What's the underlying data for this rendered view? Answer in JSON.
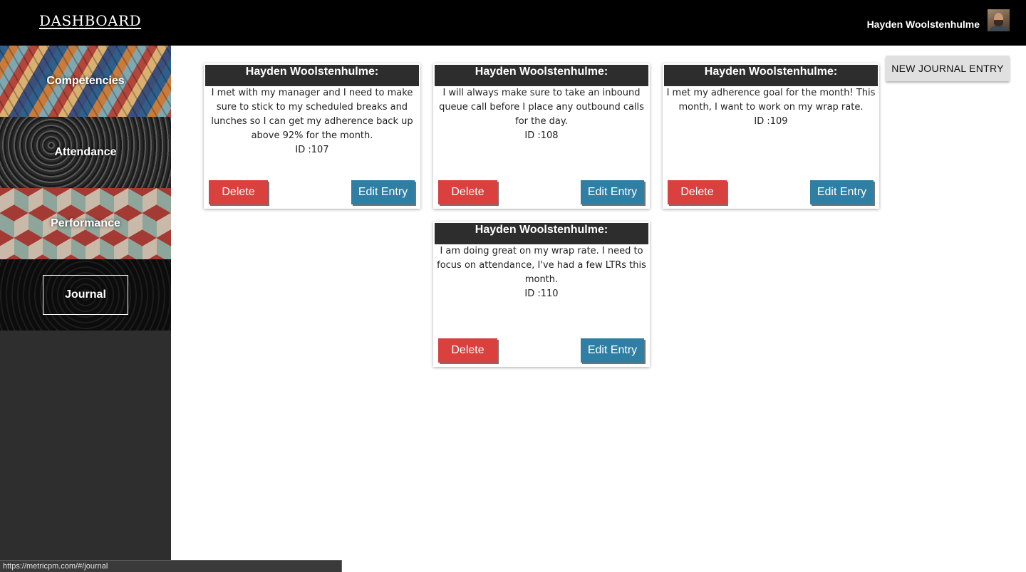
{
  "header": {
    "brand": "DASHBOARD",
    "user_name": "Hayden Woolstenhulme"
  },
  "sidebar": {
    "items": [
      {
        "label": "Competencies"
      },
      {
        "label": "Attendance"
      },
      {
        "label": "Performance"
      },
      {
        "label": "Journal"
      }
    ]
  },
  "toolbar": {
    "new_entry_label": "NEW JOURNAL ENTRY"
  },
  "entries": [
    {
      "author": "Hayden Woolstenhulme:",
      "text": "I met with my manager and I need to make sure to stick to my scheduled breaks and lunches so I can get my adherence back up above 92% for the month.",
      "id_label": "ID :107",
      "delete_label": "Delete",
      "edit_label": "Edit Entry"
    },
    {
      "author": "Hayden Woolstenhulme:",
      "text": "I will always make sure to take an inbound queue call before I place any outbound calls for the day.",
      "id_label": "ID :108",
      "delete_label": "Delete",
      "edit_label": "Edit Entry"
    },
    {
      "author": "Hayden Woolstenhulme:",
      "text": "I met my adherence goal for the month! This month, I want to work on my wrap rate.",
      "id_label": "ID :109",
      "delete_label": "Delete",
      "edit_label": "Edit Entry"
    },
    {
      "author": "Hayden Woolstenhulme:",
      "text": "I am doing great on my wrap rate. I need to focus on attendance, I've had a few LTRs this month.",
      "id_label": "ID :110",
      "delete_label": "Delete",
      "edit_label": "Edit Entry"
    }
  ],
  "status_bar": {
    "url": "https://metricpm.com/#/journal"
  }
}
